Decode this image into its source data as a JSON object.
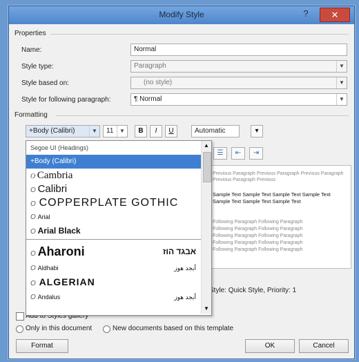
{
  "window": {
    "title": "Modify Style",
    "help_glyph": "?",
    "close_glyph": "✕"
  },
  "properties": {
    "section_label": "Properties",
    "name_label": "Name:",
    "name_value": "Normal",
    "style_type_label": "Style type:",
    "style_type_value": "Paragraph",
    "style_based_label": "Style based on:",
    "style_based_value": "(no style)",
    "following_label": "Style for following paragraph:",
    "following_value": "¶ Normal"
  },
  "formatting": {
    "section_label": "Formatting",
    "font_value": "+Body (Calibri)",
    "size_value": "11",
    "bold": "B",
    "italic": "I",
    "underline": "U",
    "color_value": "Automatic"
  },
  "font_list": {
    "items": [
      {
        "label": "Segoe UI (Headings)",
        "style": "small"
      },
      {
        "label": "+Body (Calibri)",
        "style": "selected"
      },
      {
        "label": "Cambria",
        "style": "serif"
      },
      {
        "label": "Calibri",
        "style": "sans"
      },
      {
        "label": "COPPERPLATE GOTHIC",
        "style": "copper"
      },
      {
        "label": "Arial",
        "style": "small"
      },
      {
        "label": "Arial Black",
        "style": "blackish"
      },
      {
        "label": "Aharoni",
        "style": "aharoni",
        "sample": "אבגד הוז"
      },
      {
        "label": "Aldhabi",
        "style": "small",
        "sample": "أبجد هوز"
      },
      {
        "label": "ALGERIAN",
        "style": "algerian"
      },
      {
        "label": "Andalus",
        "style": "small",
        "sample": "أبجد هوز"
      }
    ]
  },
  "preview": {
    "line_a": "Previous Paragraph Previous Paragraph Previous Paragraph",
    "line_b": "Previous Paragraph Previous",
    "sample_a": "Sample Text Sample Text Sample Text Sample Text",
    "sample_b": "Sample Text Sample Text Sample Text",
    "follow_a": "Following Paragraph Following Paragraph",
    "follow_b": "Following Paragraph Following Paragraph",
    "follow_c": "Following Paragraph Following Paragraph",
    "follow_d": "Following Paragraph Following Paragraph",
    "follow_e": "Following Paragraph Following Paragraph",
    "description": "Style: Quick Style, Priority: 1"
  },
  "options": {
    "add_to_styles_label": "Add to Styles gallery",
    "only_doc_label": "Only in this document",
    "new_docs_label": "New documents based on this template"
  },
  "buttons": {
    "format": "Format",
    "ok": "OK",
    "cancel": "Cancel"
  }
}
